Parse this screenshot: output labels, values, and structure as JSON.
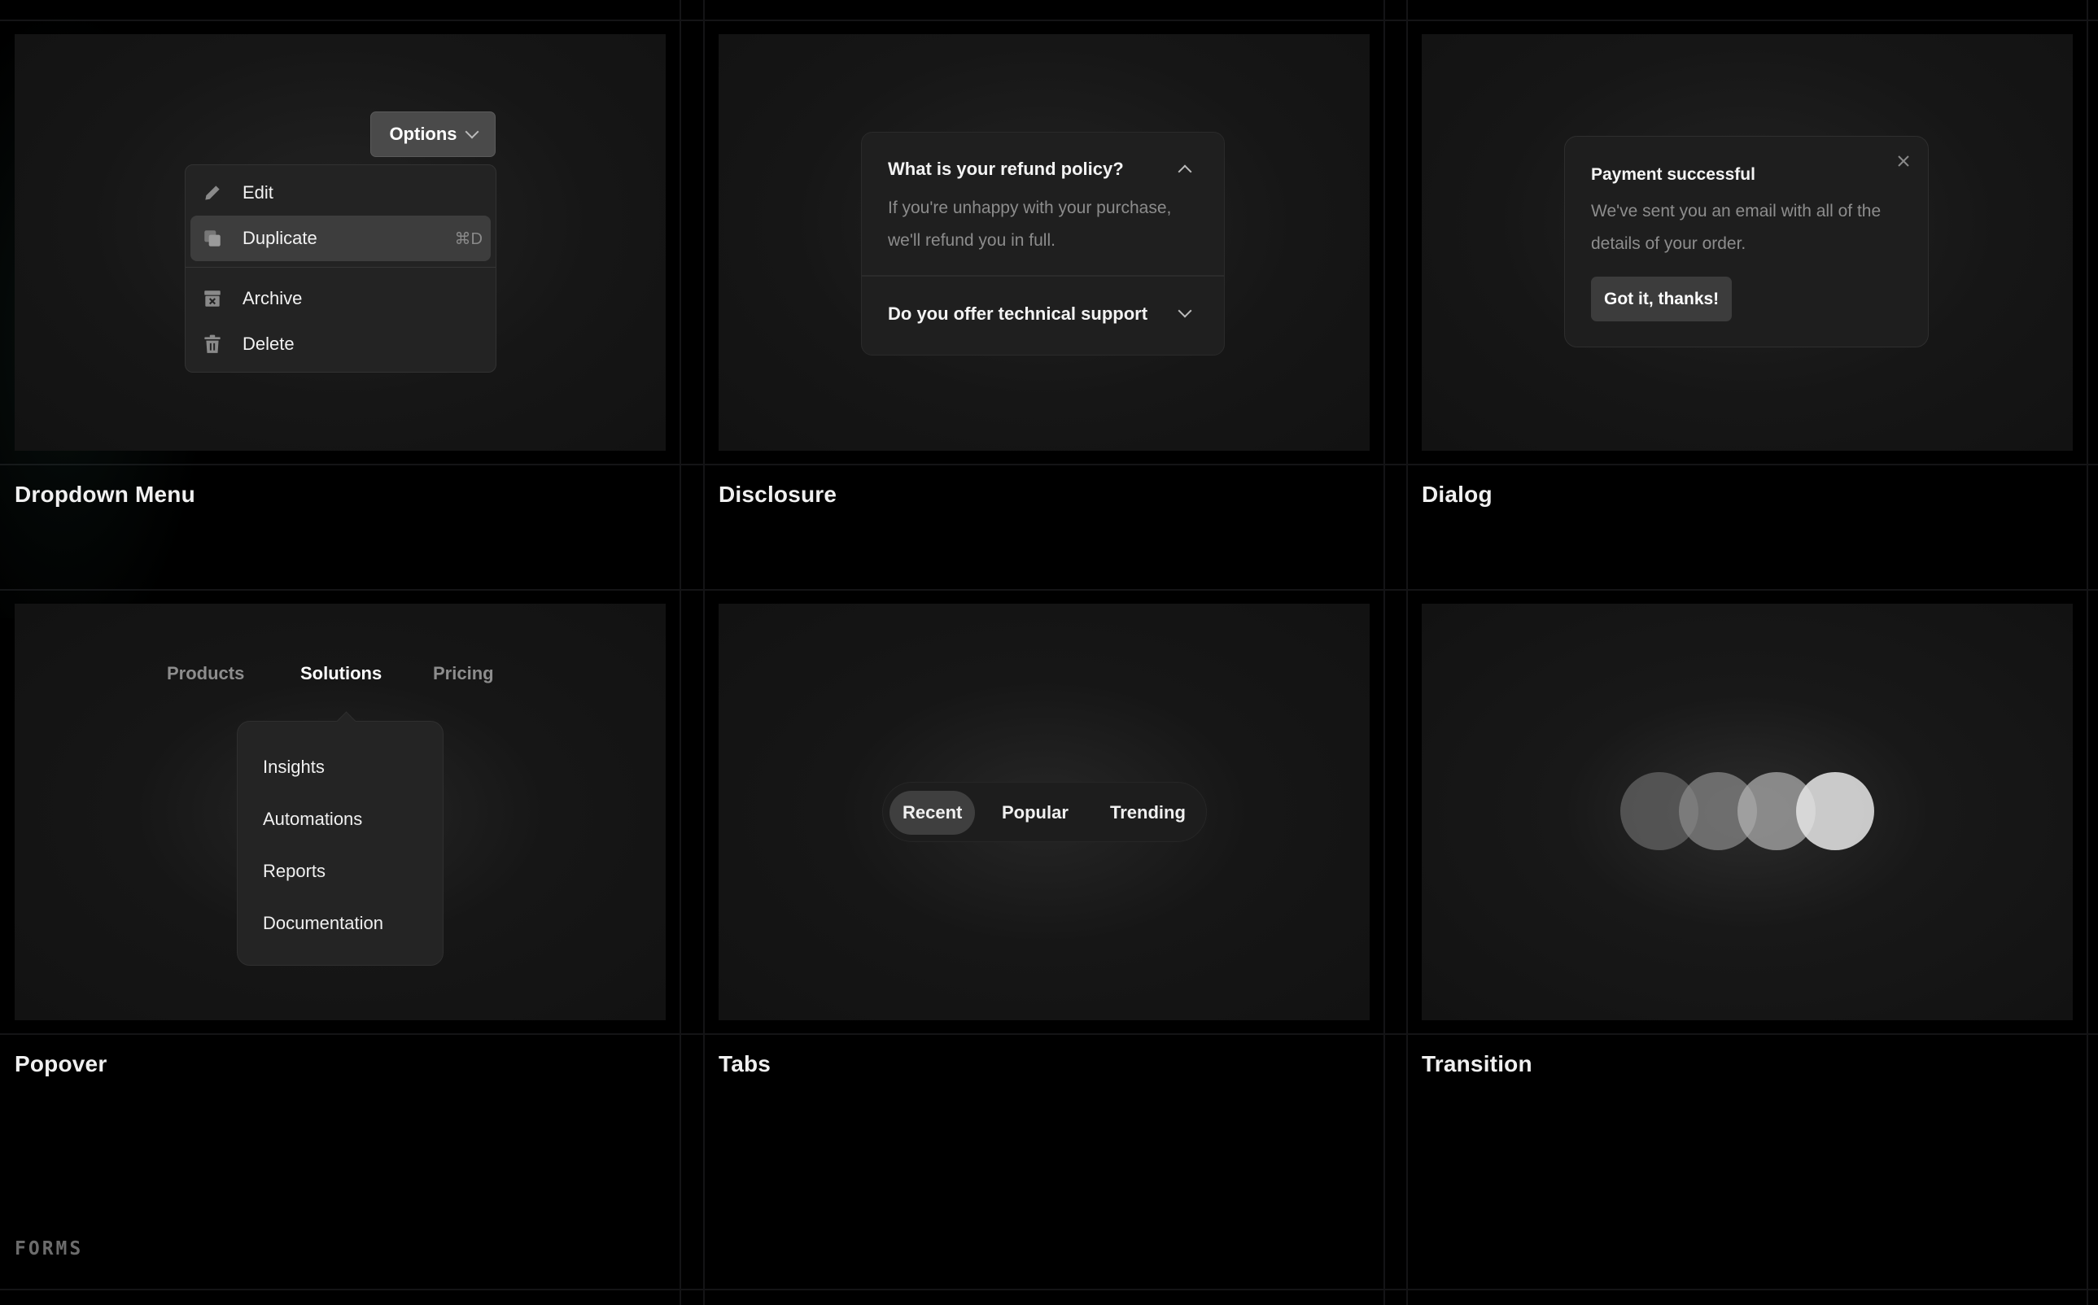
{
  "cards": {
    "dropdown": {
      "title": "Dropdown Menu"
    },
    "disclosure": {
      "title": "Disclosure"
    },
    "dialog": {
      "title": "Dialog"
    },
    "popover": {
      "title": "Popover"
    },
    "tabs": {
      "title": "Tabs"
    },
    "transition": {
      "title": "Transition"
    }
  },
  "dropdown": {
    "button_label": "Options",
    "items": [
      {
        "label": "Edit",
        "icon": "pencil-icon"
      },
      {
        "label": "Duplicate",
        "icon": "duplicate-icon",
        "shortcut": "⌘D",
        "active": true
      },
      {
        "label": "Archive",
        "icon": "archive-icon"
      },
      {
        "label": "Delete",
        "icon": "trash-icon"
      }
    ]
  },
  "disclosure": {
    "q1": "What is your refund policy?",
    "a1": "If you're unhappy with your purchase, we'll refund you in full.",
    "q2": "Do you offer technical support"
  },
  "dialog": {
    "title": "Payment successful",
    "body": "We've sent you an email with all of the details of your order.",
    "button": "Got it, thanks!"
  },
  "popover": {
    "nav": [
      "Products",
      "Solutions",
      "Pricing"
    ],
    "active_nav": "Solutions",
    "items": [
      "Insights",
      "Automations",
      "Reports",
      "Documentation"
    ]
  },
  "tabs": {
    "items": [
      "Recent",
      "Popular",
      "Trending"
    ],
    "active": "Recent"
  },
  "footer": {
    "section_label": "FORMS"
  },
  "colors": {
    "background": "#000000",
    "preview": "#141414",
    "grid_line": "#141416"
  }
}
